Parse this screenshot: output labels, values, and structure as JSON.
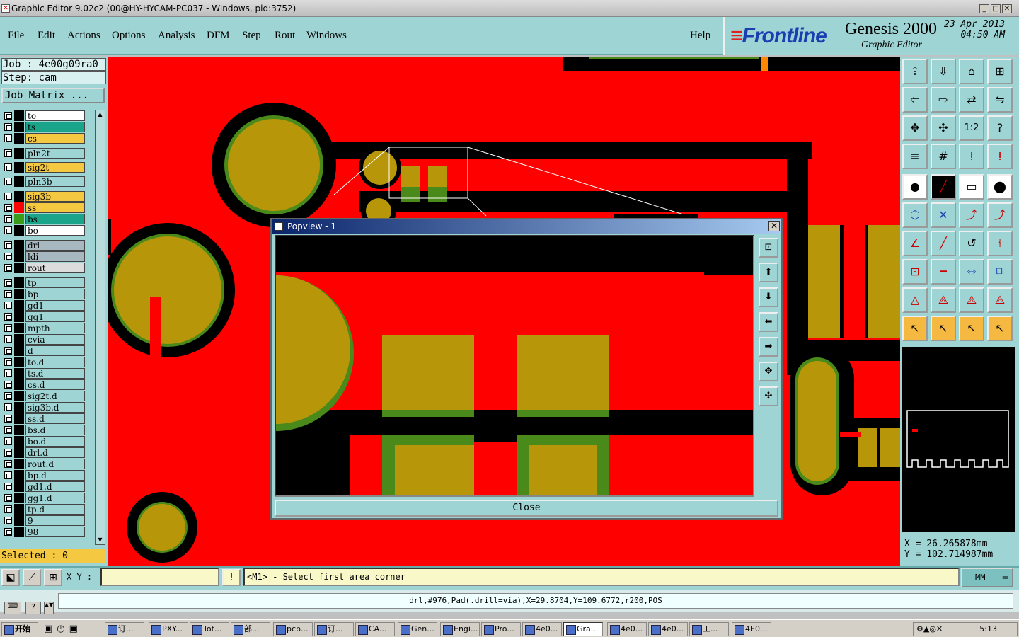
{
  "window": {
    "title": "Graphic Editor 9.02c2 (00@HY-HYCAM-PC037 - Windows, pid:3752)"
  },
  "menu": [
    "File",
    "Edit",
    "Actions",
    "Options",
    "Analysis",
    "DFM",
    "Step",
    "Rout",
    "Windows"
  ],
  "help": "Help",
  "brand": {
    "logo": "Frontline",
    "product": "Genesis 2000",
    "subtitle": "Graphic Editor",
    "date": "23 Apr 2013",
    "time": "04:50 AM"
  },
  "job": {
    "job_line": "Job : 4e00g09ra0",
    "step_line": "Step: cam",
    "matrix_button": "Job Matrix ..."
  },
  "layers": [
    {
      "name": "to",
      "color": "#ffffff"
    },
    {
      "name": "ts",
      "color": "#1aa58a"
    },
    {
      "name": "cs",
      "color": "#f5c842"
    },
    {
      "name": "pln2t",
      "color": "#9fd4d4"
    },
    {
      "name": "sig2t",
      "color": "#f5c842"
    },
    {
      "name": "pln3b",
      "color": "#9fd4d4"
    },
    {
      "name": "sig3b",
      "color": "#f5c842"
    },
    {
      "name": "ss",
      "color": "#f5c842"
    },
    {
      "name": "bs",
      "color": "#1aa58a"
    },
    {
      "name": "bo",
      "color": "#ffffff"
    },
    {
      "name": "drl",
      "color": "#a8b8c0"
    },
    {
      "name": "ldi",
      "color": "#a8b8c0"
    },
    {
      "name": "rout",
      "color": "#dcdcdc"
    },
    {
      "name": "tp",
      "color": "#9fd4d4"
    },
    {
      "name": "bp",
      "color": "#9fd4d4"
    },
    {
      "name": "gd1",
      "color": "#9fd4d4"
    },
    {
      "name": "gg1",
      "color": "#9fd4d4"
    },
    {
      "name": "mpth",
      "color": "#9fd4d4"
    },
    {
      "name": "cvia",
      "color": "#9fd4d4"
    },
    {
      "name": "d",
      "color": "#9fd4d4"
    },
    {
      "name": "to.d",
      "color": "#9fd4d4"
    },
    {
      "name": "ts.d",
      "color": "#9fd4d4"
    },
    {
      "name": "cs.d",
      "color": "#9fd4d4"
    },
    {
      "name": "sig2t.d",
      "color": "#9fd4d4"
    },
    {
      "name": "sig3b.d",
      "color": "#9fd4d4"
    },
    {
      "name": "ss.d",
      "color": "#9fd4d4"
    },
    {
      "name": "bs.d",
      "color": "#9fd4d4"
    },
    {
      "name": "bo.d",
      "color": "#9fd4d4"
    },
    {
      "name": "drl.d",
      "color": "#9fd4d4"
    },
    {
      "name": "rout.d",
      "color": "#9fd4d4"
    },
    {
      "name": "bp.d",
      "color": "#9fd4d4"
    },
    {
      "name": "gd1.d",
      "color": "#9fd4d4"
    },
    {
      "name": "gg1.d",
      "color": "#9fd4d4"
    },
    {
      "name": "tp.d",
      "color": "#9fd4d4"
    },
    {
      "name": "9",
      "color": "#9fd4d4"
    },
    {
      "name": "98",
      "color": "#9fd4d4"
    }
  ],
  "selected": "Selected : 0",
  "popup": {
    "title": "Popview - 1",
    "close": "Close"
  },
  "coords": {
    "x": "X  =  26.265878mm",
    "y": "Y  =  102.714987mm"
  },
  "bottom": {
    "xy_label": "X Y :",
    "status": "<M1> - Select first area corner",
    "unit": "MM"
  },
  "info": "drl,#976,Pad(.drill=via),X=29.8704,Y=109.6772,r200,POS",
  "taskbar": {
    "start": "开始",
    "tasks": [
      "订...",
      "PXY...",
      "Tot...",
      "部...",
      "pcb...",
      "订...",
      "CA...",
      "Gen...",
      "Engi...",
      "Pro...",
      "4e0...",
      "Gra...",
      "4e0...",
      "4e0...",
      "工...",
      "4E0..."
    ],
    "clock": "5:13"
  },
  "colors": {
    "copper": "#ff0000",
    "pad": "#b8960a",
    "mask": "#3a9a1a",
    "panel": "#9fd4d4"
  }
}
